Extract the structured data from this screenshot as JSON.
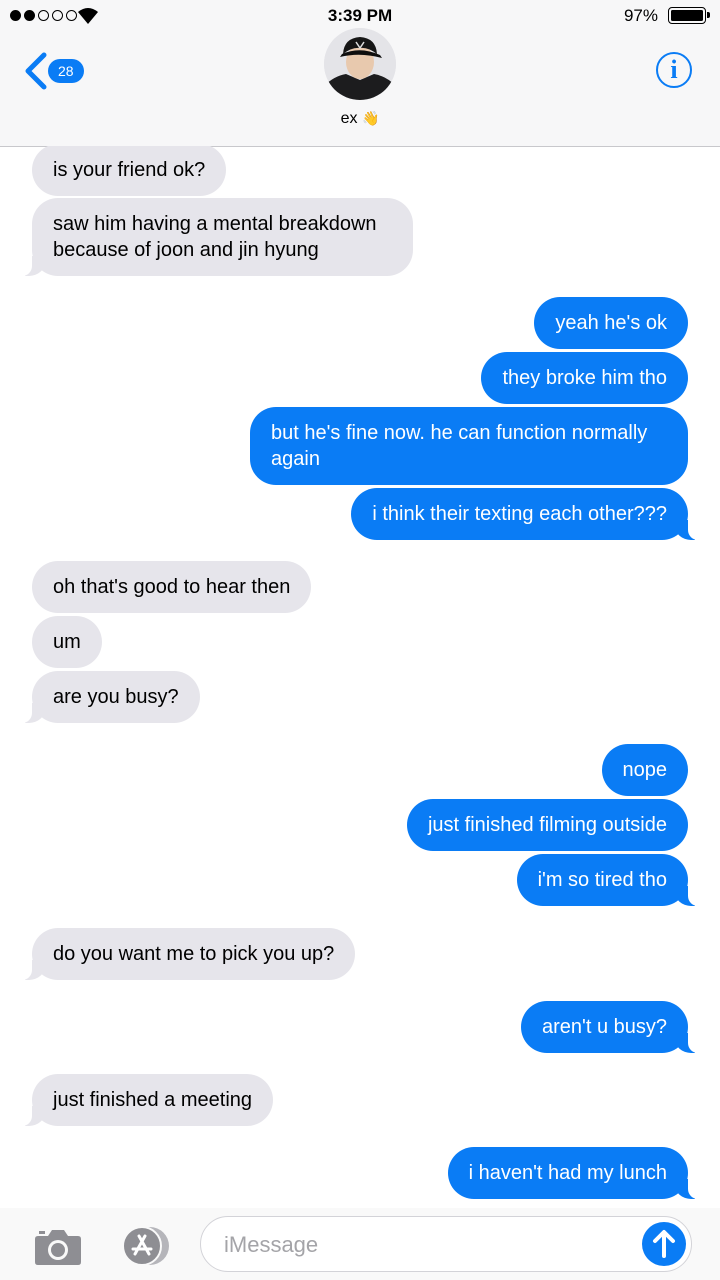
{
  "status_bar": {
    "time": "3:39 PM",
    "battery_percent": "97%",
    "signal_bars_filled": 2,
    "signal_bars_total": 5
  },
  "header": {
    "back_badge_count": "28",
    "contact_name": "ex",
    "contact_emoji": "👋",
    "info_label": "i"
  },
  "messages": [
    {
      "from": "them",
      "text": "is your friend ok?"
    },
    {
      "from": "them",
      "text": "saw him having a mental breakdown because of joon and jin hyung"
    },
    {
      "from": "me",
      "text": "yeah he's ok"
    },
    {
      "from": "me",
      "text": "they broke him tho"
    },
    {
      "from": "me",
      "text": "but he's fine now. he can function normally again"
    },
    {
      "from": "me",
      "text": "i think their texting each other???"
    },
    {
      "from": "them",
      "text": "oh that's good to hear then"
    },
    {
      "from": "them",
      "text": "um"
    },
    {
      "from": "them",
      "text": "are you busy?"
    },
    {
      "from": "me",
      "text": "nope"
    },
    {
      "from": "me",
      "text": "just finished filming outside"
    },
    {
      "from": "me",
      "text": "i'm so tired tho"
    },
    {
      "from": "them",
      "text": "do you want me to pick you up?"
    },
    {
      "from": "me",
      "text": "aren't u busy?"
    },
    {
      "from": "them",
      "text": "just finished a meeting"
    },
    {
      "from": "me",
      "text": "i haven't had my lunch"
    }
  ],
  "input": {
    "placeholder": "iMessage"
  },
  "icons": {
    "back": "chevron-left-icon",
    "info": "info-icon",
    "camera": "camera-icon",
    "apps": "app-store-icon",
    "send": "send-arrow-icon"
  },
  "colors": {
    "accent": "#0a7cf5",
    "incoming_bubble": "#e6e5eb",
    "outgoing_text": "#ffffff"
  }
}
